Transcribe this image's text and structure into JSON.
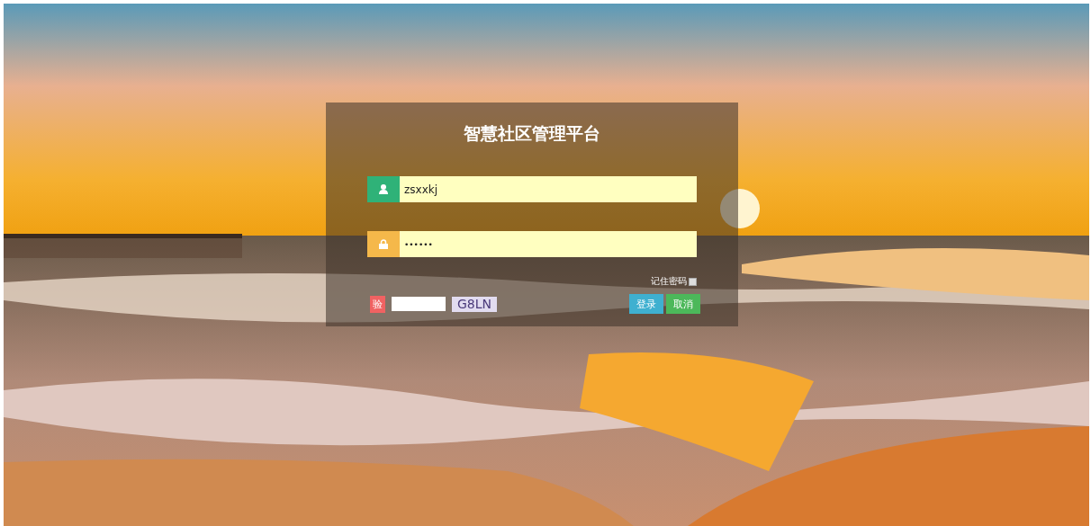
{
  "login": {
    "title": "智慧社区管理平台",
    "username": {
      "value": "zsxxkj"
    },
    "password": {
      "value": "••••••"
    },
    "remember": {
      "label": "记住密码",
      "checked": false
    },
    "captcha": {
      "badge": "验",
      "code": "G8LN"
    },
    "buttons": [
      {
        "label": "登录",
        "kind": "primary"
      },
      {
        "label": "取消",
        "kind": "secondary"
      }
    ]
  }
}
